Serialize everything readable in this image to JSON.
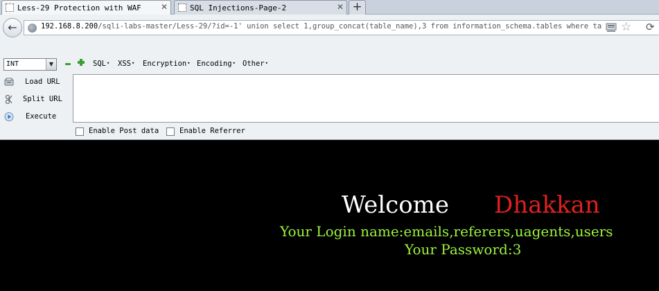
{
  "tabs": [
    {
      "label": "Less-29 Protection with WAF",
      "active": true
    },
    {
      "label": "SQL Injections-Page-2",
      "active": false
    }
  ],
  "new_tab_label": "+",
  "nav": {
    "back_icon": "back-arrow-icon",
    "url_host": "192.168.8.200",
    "url_rest": "/sqli-labs-master/Less-29/?id=-1' union select 1,group_concat(table_name),3 from information_schema.tables where table_sch"
  },
  "hackbar": {
    "select_value": "INT",
    "menus": [
      "SQL",
      "XSS",
      "Encryption",
      "Encoding",
      "Other"
    ],
    "actions": [
      {
        "label": "Load URL",
        "icon": "load-url-icon"
      },
      {
        "label": "Split URL",
        "icon": "split-url-icon"
      },
      {
        "label": "Execute",
        "icon": "execute-icon"
      }
    ],
    "checkboxes": [
      {
        "label": "Enable Post data",
        "checked": false
      },
      {
        "label": "Enable Referrer",
        "checked": false
      }
    ]
  },
  "page": {
    "welcome": "Welcome",
    "name": "Dhakkan",
    "login_line": "Your Login name:emails,referers,uagents,users",
    "password_line": "Your Password:3"
  },
  "colors": {
    "background": "#000000",
    "welcome": "#ffffff",
    "name": "#e0201c",
    "info": "#9cf43a"
  }
}
